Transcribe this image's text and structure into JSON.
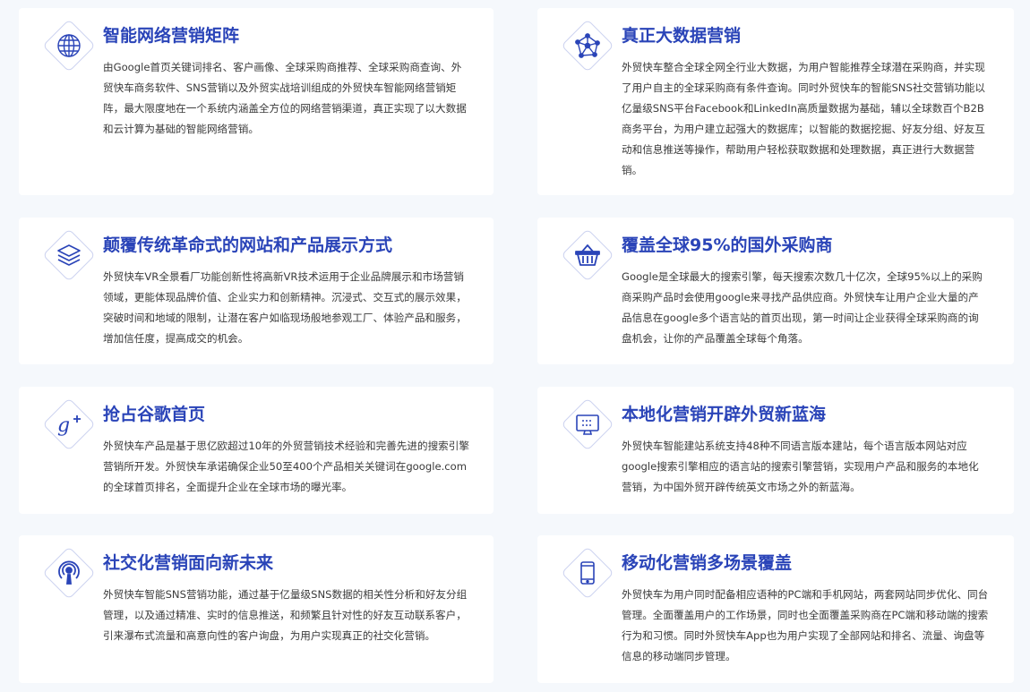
{
  "accent_color": "#2a44b8",
  "features": [
    {
      "icon": "globe-icon",
      "title": "智能网络营销矩阵",
      "desc": "由Google首页关键词排名、客户画像、全球采购商推荐、全球采购商查询、外贸快车商务软件、SNS营销以及外贸实战培训组成的外贸快车智能网络营销矩阵，最大限度地在一个系统内涵盖全方位的网络营销渠道，真正实现了以大数据和云计算为基础的智能网络营销。"
    },
    {
      "icon": "network-icon",
      "title": "真正大数据营销",
      "desc": "外贸快车整合全球全网全行业大数据，为用户智能推荐全球潜在采购商，并实现了用户自主的全球采购商有条件查询。同时外贸快车的智能SNS社交营销功能以亿量级SNS平台Facebook和LinkedIn高质量数据为基础，辅以全球数百个B2B商务平台，为用户建立起强大的数据库；以智能的数据挖掘、好友分组、好友互动和信息推送等操作，帮助用户轻松获取数据和处理数据，真正进行大数据营销。"
    },
    {
      "icon": "layers-icon",
      "title": "颠覆传统革命式的网站和产品展示方式",
      "desc": "外贸快车VR全景看厂功能创新性将高新VR技术运用于企业品牌展示和市场营销领域，更能体现品牌价值、企业实力和创新精神。沉浸式、交互式的展示效果，突破时间和地域的限制，让潜在客户如临现场般地参观工厂、体验产品和服务，增加信任度，提高成交的机会。"
    },
    {
      "icon": "basket-icon",
      "title": "覆盖全球95%的国外采购商",
      "desc": "Google是全球最大的搜索引擎，每天搜索次数几十亿次，全球95%以上的采购商采购产品时会使用google来寻找产品供应商。外贸快车让用户企业大量的产品信息在google多个语言站的首页出现，第一时间让企业获得全球采购商的询盘机会，让你的产品覆盖全球每个角落。"
    },
    {
      "icon": "google-plus-icon",
      "title": "抢占谷歌首页",
      "desc": "外贸快车产品是基于思亿欧超过10年的外贸营销技术经验和完善先进的搜索引擎营销所开发。外贸快车承诺确保企业50至400个产品相关关键词在google.com的全球首页排名，全面提升企业在全球市场的曝光率。"
    },
    {
      "icon": "monitor-icon",
      "title": "本地化营销开辟外贸新蓝海",
      "desc": "外贸快车智能建站系统支持48种不同语言版本建站，每个语言版本网站对应google搜索引擎相应的语言站的搜索引擎营销，实现用户产品和服务的本地化营销，为中国外贸开辟传统英文市场之外的新蓝海。"
    },
    {
      "icon": "podcast-icon",
      "title": "社交化营销面向新未来",
      "desc": "外贸快车智能SNS营销功能，通过基于亿量级SNS数据的相关性分析和好友分组管理，以及通过精准、实时的信息推送，和频繁且针对性的好友互动联系客户，引来瀑布式流量和高意向性的客户询盘，为用户实现真正的社交化营销。"
    },
    {
      "icon": "mobile-phone-icon",
      "title": "移动化营销多场景覆盖",
      "desc": "外贸快车为用户同时配备相应语种的PC端和手机网站，两套网站同步优化、同台管理。全面覆盖用户的工作场景，同时也全面覆盖采购商在PC端和移动端的搜索行为和习惯。同时外贸快车App也为用户实现了全部网站和排名、流量、询盘等信息的移动端同步管理。"
    }
  ]
}
